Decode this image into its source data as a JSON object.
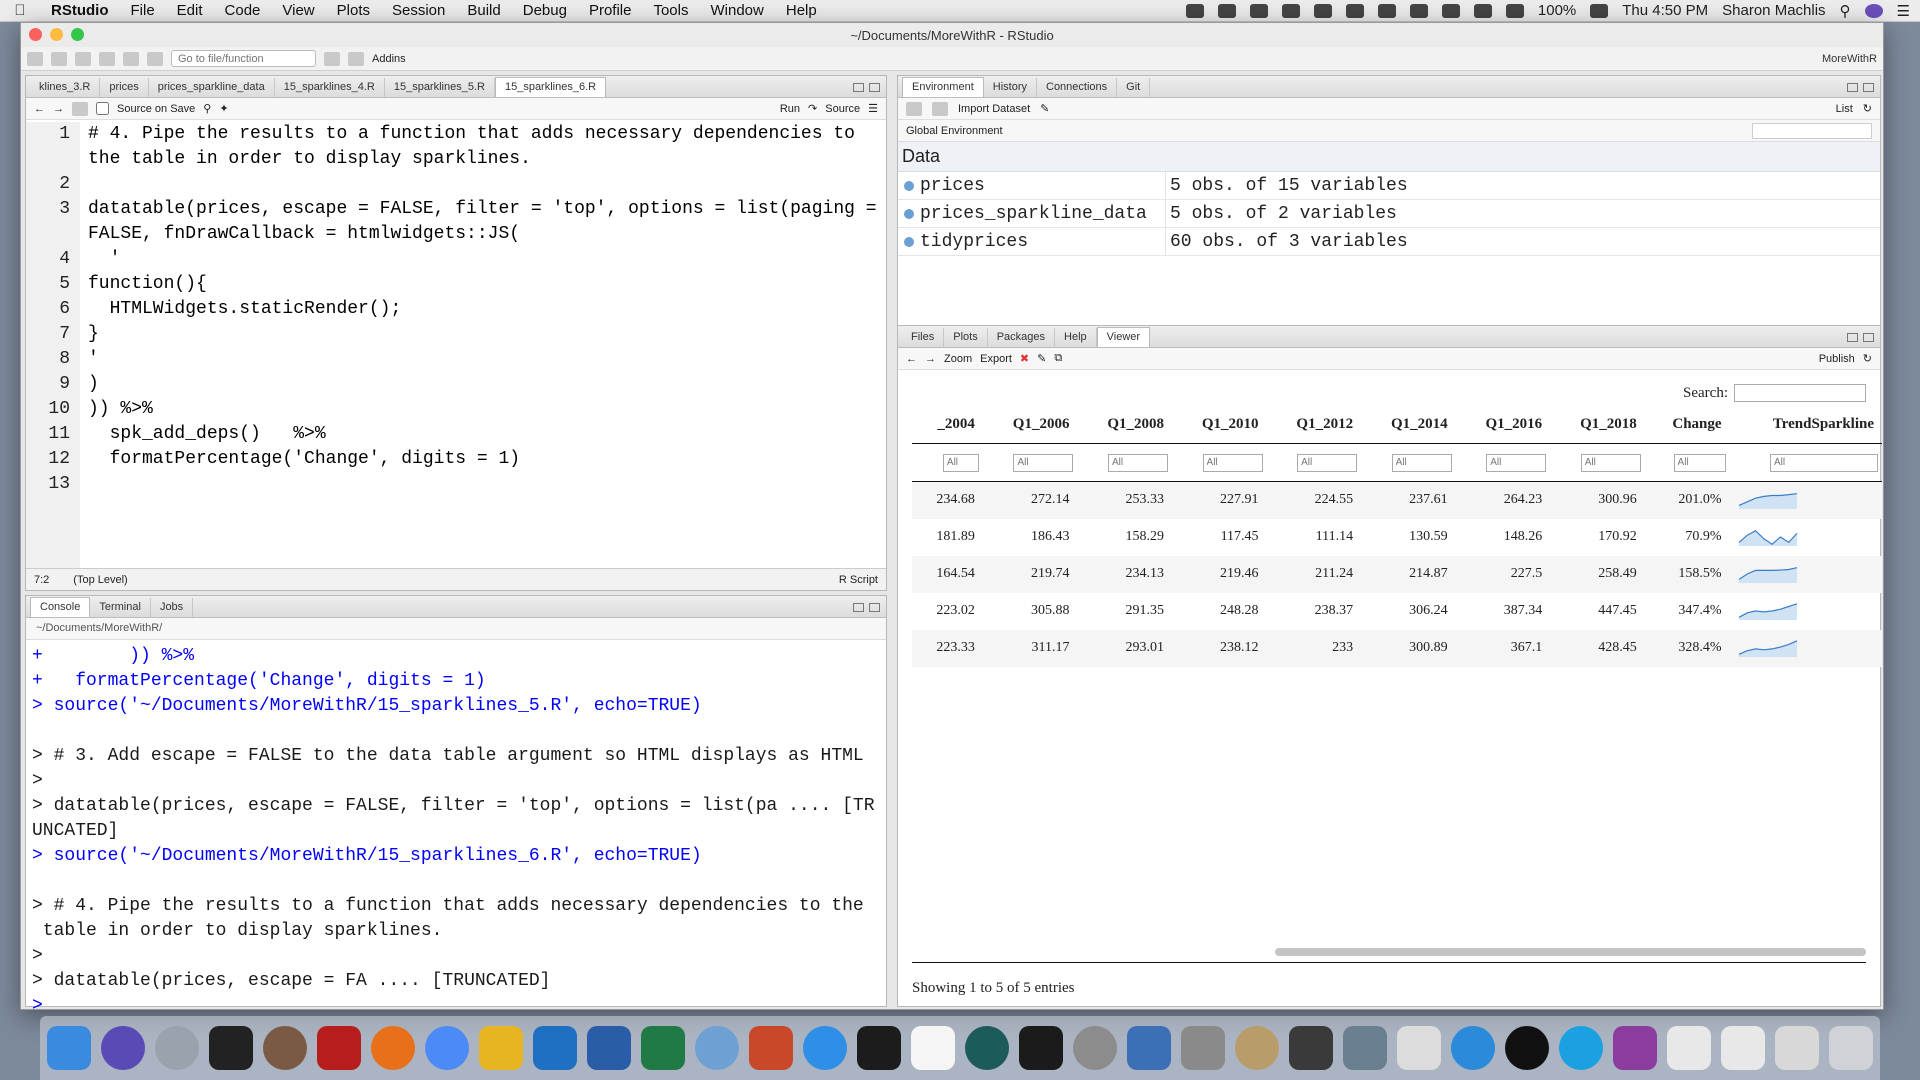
{
  "menubar": {
    "app": "RStudio",
    "items": [
      "File",
      "Edit",
      "Code",
      "View",
      "Plots",
      "Session",
      "Build",
      "Debug",
      "Profile",
      "Tools",
      "Window",
      "Help"
    ],
    "battery": "100%",
    "clock": "Thu 4:50 PM",
    "user": "Sharon Machlis"
  },
  "window": {
    "title": "~/Documents/MoreWithR - RStudio"
  },
  "toolbar": {
    "goto_placeholder": "Go to file/function",
    "addins": "Addins",
    "project": "MoreWithR"
  },
  "editor": {
    "tabs": [
      "klines_3.R",
      "prices",
      "prices_sparkline_data",
      "15_sparklines_4.R",
      "15_sparklines_5.R",
      "15_sparklines_6.R"
    ],
    "source_on_save": "Source on Save",
    "run": "Run",
    "source": "Source",
    "lines": [
      {
        "n": "1",
        "text": "# 4. Pipe the results to a function that adds necessary dependencies to"
      },
      {
        "n": "",
        "text": "the table in order to display sparklines."
      },
      {
        "n": "2",
        "text": ""
      },
      {
        "n": "3",
        "text": "datatable(prices, escape = FALSE, filter = 'top', options = list(paging ="
      },
      {
        "n": "",
        "text": "FALSE, fnDrawCallback = htmlwidgets::JS("
      },
      {
        "n": "4",
        "text": "  '"
      },
      {
        "n": "5",
        "text": "function(){"
      },
      {
        "n": "6",
        "text": "  HTMLWidgets.staticRender();"
      },
      {
        "n": "7",
        "text": "}"
      },
      {
        "n": "8",
        "text": "'"
      },
      {
        "n": "9",
        "text": ")"
      },
      {
        "n": "10",
        "text": ")) %>%"
      },
      {
        "n": "11",
        "text": "  spk_add_deps()   %>%"
      },
      {
        "n": "12",
        "text": "  formatPercentage('Change', digits = 1)"
      },
      {
        "n": "13",
        "text": ""
      }
    ],
    "status_pos": "7:2",
    "status_level": "(Top Level)",
    "status_type": "R Script"
  },
  "console": {
    "tabs": [
      "Console",
      "Terminal",
      "Jobs"
    ],
    "path": "~/Documents/MoreWithR/",
    "lines": [
      "+        )) %>%",
      "+   formatPercentage('Change', digits = 1)",
      "> source('~/Documents/MoreWithR/15_sparklines_5.R', echo=TRUE)",
      "",
      "> # 3. Add escape = FALSE to the data table argument so HTML displays as HTML",
      ">",
      "> datatable(prices, escape = FALSE, filter = 'top', options = list(pa .... [TR",
      "UNCATED]",
      "> source('~/Documents/MoreWithR/15_sparklines_6.R', echo=TRUE)",
      "",
      "> # 4. Pipe the results to a function that adds necessary dependencies to the",
      " table in order to display sparklines.",
      ">",
      "> datatable(prices, escape = FA .... [TRUNCATED]",
      "> "
    ]
  },
  "environment": {
    "tabs": [
      "Environment",
      "History",
      "Connections",
      "Git"
    ],
    "import": "Import Dataset",
    "list": "List",
    "scope": "Global Environment",
    "section": "Data",
    "rows": [
      {
        "name": "prices",
        "value": "5 obs. of 15 variables"
      },
      {
        "name": "prices_sparkline_data",
        "value": "5 obs. of 2 variables"
      },
      {
        "name": "tidyprices",
        "value": "60 obs. of 3 variables"
      }
    ]
  },
  "viewer": {
    "tabs": [
      "Files",
      "Plots",
      "Packages",
      "Help",
      "Viewer"
    ],
    "zoom": "Zoom",
    "export": "Export",
    "publish": "Publish",
    "search_label": "Search:",
    "filter_placeholder": "All",
    "columns": [
      "_2004",
      "Q1_2006",
      "Q1_2008",
      "Q1_2010",
      "Q1_2012",
      "Q1_2014",
      "Q1_2016",
      "Q1_2018",
      "Change",
      "TrendSparkline"
    ],
    "rows": [
      {
        "cells": [
          "234.68",
          "272.14",
          "253.33",
          "227.91",
          "224.55",
          "237.61",
          "264.23",
          "300.96",
          "201.0%"
        ],
        "trend": [
          0.2,
          0.4,
          0.6,
          0.7,
          0.75,
          0.75,
          0.8,
          0.85
        ]
      },
      {
        "cells": [
          "181.89",
          "186.43",
          "158.29",
          "117.45",
          "111.14",
          "130.59",
          "148.26",
          "170.92",
          "70.9%"
        ],
        "trend": [
          0.2,
          0.6,
          0.85,
          0.4,
          0.1,
          0.5,
          0.2,
          0.7
        ]
      },
      {
        "cells": [
          "164.54",
          "219.74",
          "234.13",
          "219.46",
          "211.24",
          "214.87",
          "227.5",
          "258.49",
          "158.5%"
        ],
        "trend": [
          0.2,
          0.5,
          0.7,
          0.7,
          0.7,
          0.72,
          0.75,
          0.85
        ]
      },
      {
        "cells": [
          "223.02",
          "305.88",
          "291.35",
          "248.28",
          "238.37",
          "306.24",
          "387.34",
          "447.45",
          "347.4%"
        ],
        "trend": [
          0.15,
          0.4,
          0.5,
          0.45,
          0.5,
          0.6,
          0.75,
          0.9
        ]
      },
      {
        "cells": [
          "223.33",
          "311.17",
          "293.01",
          "238.12",
          "233",
          "300.89",
          "367.1",
          "428.45",
          "328.4%"
        ],
        "trend": [
          0.15,
          0.35,
          0.45,
          0.4,
          0.45,
          0.55,
          0.7,
          0.9
        ]
      }
    ],
    "info": "Showing 1 to 5 of 5 entries"
  }
}
